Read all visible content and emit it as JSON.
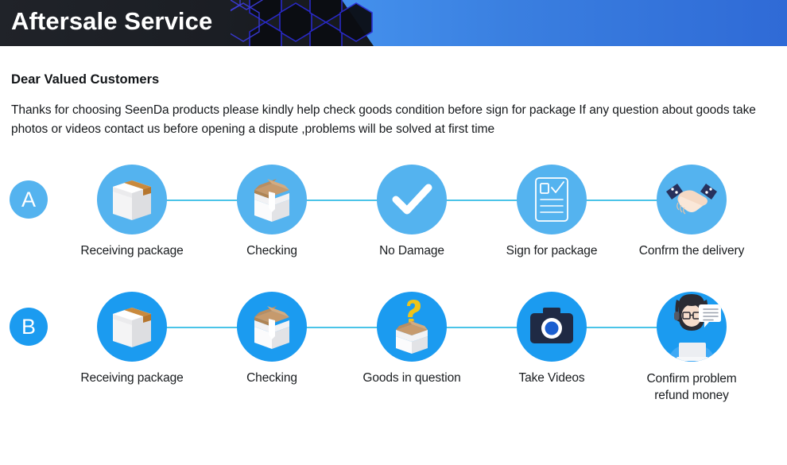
{
  "header": {
    "title": "Aftersale Service",
    "dark_panel_color": "#1b1e24",
    "accent_color": "#3a8ae8",
    "hex_outline_color": "#2a2ad0"
  },
  "intro": {
    "greeting": "Dear Valued Customers",
    "paragraph": "Thanks for choosing SeenDa products please kindly help check goods condition before sign for package If any question about goods take photos or videos contact us before opening a dispute ,problems will be solved at first time"
  },
  "flows": [
    {
      "badge": "A",
      "badge_color": "#54b3ef",
      "disc_color": "#54b3ef",
      "connector_color": "#4bc4e8",
      "steps": [
        {
          "icon": "closed-package-box-icon",
          "label": "Receiving package"
        },
        {
          "icon": "open-box-icon",
          "label": "Checking"
        },
        {
          "icon": "checkmark-icon",
          "label": "No Damage"
        },
        {
          "icon": "signed-document-icon",
          "label": "Sign for package"
        },
        {
          "icon": "handshake-icon",
          "label": "Confrm the delivery"
        }
      ]
    },
    {
      "badge": "B",
      "badge_color": "#1b9bf0",
      "disc_color": "#1b9bf0",
      "connector_color": "#4bc4e8",
      "steps": [
        {
          "icon": "closed-package-box-icon",
          "label": "Receiving package"
        },
        {
          "icon": "open-box-icon",
          "label": "Checking"
        },
        {
          "icon": "question-box-icon",
          "label": "Goods in question"
        },
        {
          "icon": "camera-icon",
          "label": "Take Videos"
        },
        {
          "icon": "support-agent-icon",
          "label": "Confirm problem\nrefund money"
        }
      ]
    }
  ]
}
